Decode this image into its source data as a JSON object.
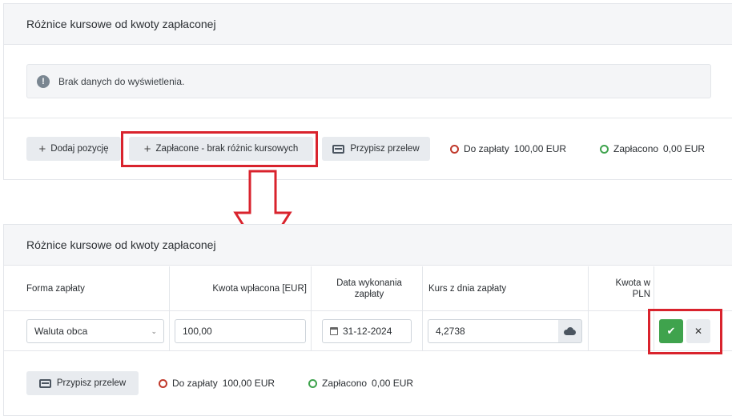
{
  "top_panel": {
    "title": "Różnice kursowe od kwoty zapłaconej",
    "alert_text": "Brak danych do wyświetlenia.",
    "buttons": {
      "add_position": "Dodaj pozycję",
      "paid_no_diff": "Zapłacone - brak różnic kursowych",
      "assign_transfer": "Przypisz przelew"
    },
    "due_label": "Do zapłaty",
    "due_value": "100,00 EUR",
    "paid_label": "Zapłacono",
    "paid_value": "0,00 EUR"
  },
  "bottom_panel": {
    "title": "Różnice kursowe od kwoty zapłaconej",
    "columns": {
      "payment_form": "Forma zapłaty",
      "amount_paid": "Kwota wpłacona [EUR]",
      "exec_date": "Data wykonania zapłaty",
      "rate": "Kurs z dnia zapłaty",
      "amount_pln": "Kwota w PLN"
    },
    "row": {
      "payment_form": "Waluta obca",
      "amount_paid": "100,00",
      "exec_date": "31-12-2024",
      "rate": "4,2738"
    },
    "assign_transfer": "Przypisz przelew",
    "due_label": "Do zapłaty",
    "due_value": "100,00 EUR",
    "paid_label": "Zapłacono",
    "paid_value": "0,00 EUR"
  },
  "icons": {
    "alert": "exclamation-circle-icon",
    "plus": "plus-icon",
    "card": "credit-card-icon",
    "calendar": "calendar-icon",
    "cloud": "cloud-download-icon",
    "check": "check-icon",
    "close": "close-icon",
    "arrow": "down-arrow-annotation"
  },
  "colors": {
    "highlight": "#d9232d",
    "due_ring": "#c0392b",
    "paid_ring": "#3fa34d",
    "confirm_button": "#3fa34d"
  }
}
